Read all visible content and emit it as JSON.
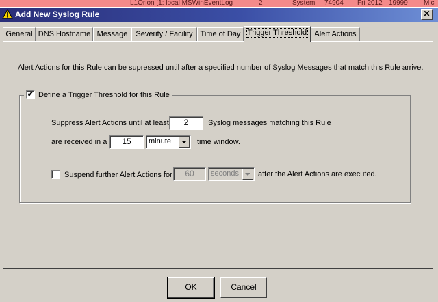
{
  "background_window": {
    "row_text": [
      "L1Orion [1: local MSWinEventLog",
      "2",
      "System",
      "74904",
      "Fri 2012",
      "19999",
      "Mic"
    ]
  },
  "dialog": {
    "title": "Add New Syslog Rule",
    "app_icon": "warning-triangle-icon",
    "close_label": "✕"
  },
  "tabs": [
    {
      "label": "General"
    },
    {
      "label": "DNS Hostname"
    },
    {
      "label": "Message"
    },
    {
      "label": "Severity / Facility"
    },
    {
      "label": "Time of Day"
    },
    {
      "label": "Trigger Threshold",
      "active": true
    },
    {
      "label": "Alert Actions"
    }
  ],
  "panel": {
    "intro": "Alert Actions for this Rule can be supressed until after a specified number of Syslog Messages that match this Rule arrive.",
    "group": {
      "checkbox_label": "Define a Trigger Threshold for this Rule",
      "checked": true,
      "checkmark": "✔",
      "suppress_label": "Suppress Alert Actions until at least",
      "count_value": "2",
      "matching_label": "Syslog messages matching this Rule",
      "received_label": "are received in a",
      "window_value": "15",
      "window_unit": "minute",
      "time_window_label": "time window.",
      "suspend_label": "Suspend further Alert Actions for",
      "suspend_checked": false,
      "suspend_value": "60",
      "suspend_unit": "seconds",
      "after_label": "after the Alert Actions are executed."
    }
  },
  "buttons": {
    "ok": "OK",
    "cancel": "Cancel"
  },
  "colors": {
    "titlebar_start": "#2a2e78",
    "titlebar_end": "#6e8fd6",
    "dialog_face": "#d4d0c8",
    "background_row": "#f48a8a"
  }
}
